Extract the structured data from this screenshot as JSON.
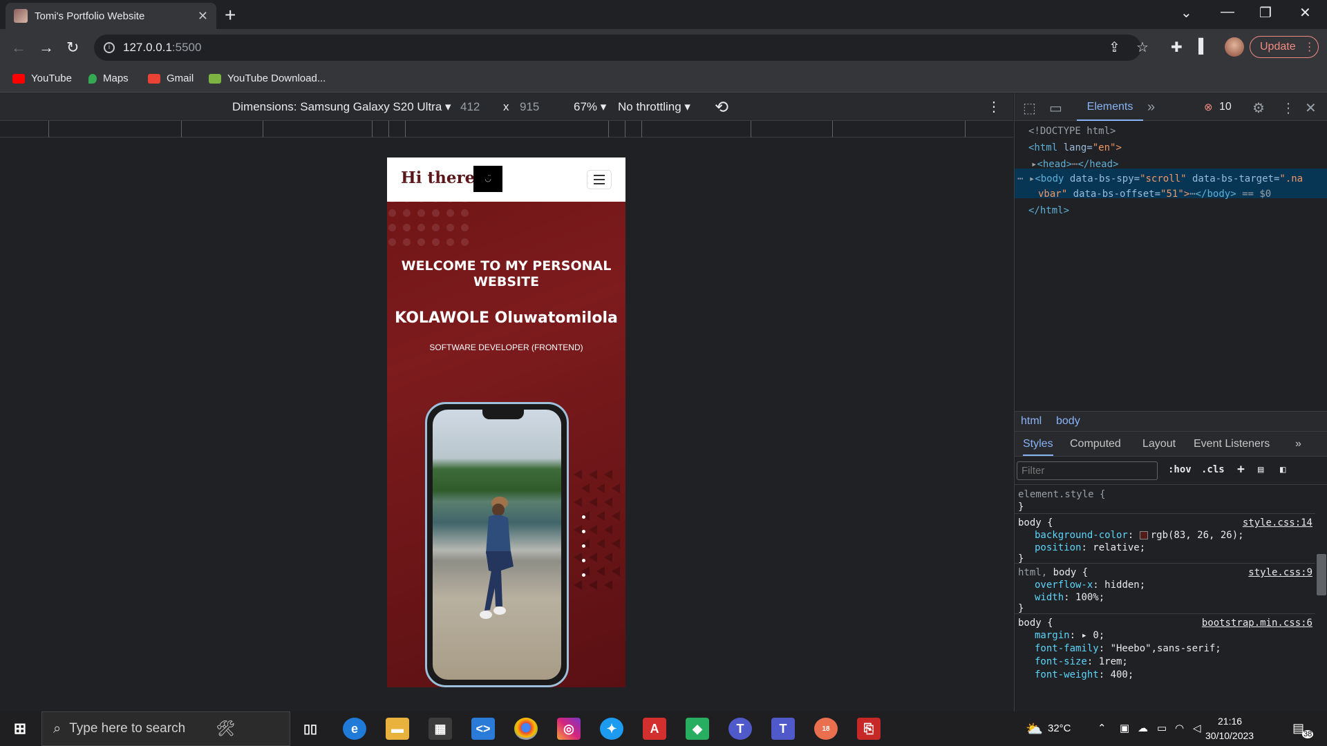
{
  "browser": {
    "tab_title": "Tomi's Portfolio Website",
    "url_host": "127.0.0.1",
    "url_port": ":5500",
    "update_label": "Update"
  },
  "bookmarks": [
    {
      "label": "YouTube",
      "color": "#ff0000"
    },
    {
      "label": "Maps",
      "color": "#34a853"
    },
    {
      "label": "Gmail",
      "color": "#ea4335"
    },
    {
      "label": "YouTube Download...",
      "color": "#7cb342"
    }
  ],
  "device_toolbar": {
    "dimensions_label": "Dimensions: Samsung Galaxy S20 Ultra",
    "width": "412",
    "times": "x",
    "height": "915",
    "zoom": "67%",
    "throttling": "No throttling"
  },
  "page": {
    "brand": "Hi there!",
    "welcome": "WELCOME TO MY PERSONAL WEBSITE",
    "name": "KOLAWOLE Oluwatomilola",
    "role": "SOFTWARE DEVELOPER (FRONTEND)",
    "colors": {
      "background": "#6e1416",
      "brand": "#5a1518"
    }
  },
  "devtools": {
    "tab_elements": "Elements",
    "error_count": "10",
    "dom": {
      "doctype": "<!DOCTYPE html>",
      "html_open_tag": "<html",
      "html_lang_attr": "lang=",
      "html_lang_val": "\"en\">",
      "head": "<head>",
      "head_close": "</head>",
      "body_tag": "<body",
      "body_attr1": "data-bs-spy=",
      "body_val1": "\"scroll\"",
      "body_attr2": "data-bs-target=",
      "body_val2": "\".na",
      "body_line2": "vbar\"",
      "body_attr3": "data-bs-offset=",
      "body_val3": "\"51\">",
      "body_close": "</body>",
      "body_eq": "== $0",
      "html_close": "</html>"
    },
    "breadcrumbs": [
      "html",
      "body"
    ],
    "subtabs": [
      "Styles",
      "Computed",
      "Layout",
      "Event Listeners"
    ],
    "filter_placeholder": "Filter",
    "hov": ":hov",
    "cls": ".cls",
    "rules": {
      "r0_sel": "element.style {",
      "close": "}",
      "r1_sel": "body {",
      "r1_src": "style.css:14",
      "r1_p1": "background-color",
      "r1_v1": "rgb(83, 26, 26);",
      "r1_swatch": "#531a1a",
      "r1_p2": "position",
      "r1_v2": "relative;",
      "r2_sel_a": "html,",
      "r2_sel_b": "body {",
      "r2_src": "style.css:9",
      "r2_p1": "overflow-x",
      "r2_v1": "hidden;",
      "r2_p2": "width",
      "r2_v2": "100%;",
      "r3_sel": "body {",
      "r3_src": "bootstrap.min.css:6",
      "r3_p1": "margin",
      "r3_v1": "0;",
      "r3_p2": "font-family",
      "r3_v2": "\"Heebo\",sans-serif;",
      "r3_p3": "font-size",
      "r3_v3": "1rem;",
      "r3_p4": "font-weight",
      "r3_v4": "400;"
    }
  },
  "taskbar": {
    "search_placeholder": "Type here to search",
    "temperature": "32°C",
    "time": "21:16",
    "date": "30/10/2023",
    "teams_badge": "18",
    "notifications": "38"
  }
}
